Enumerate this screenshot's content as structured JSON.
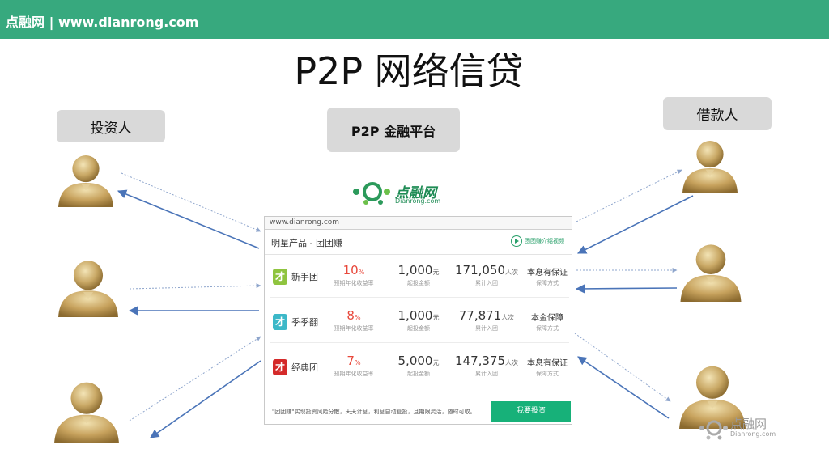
{
  "header": {
    "text": "点融网 | www.dianrong.com",
    "color": "#37a97e"
  },
  "title": "P2P 网络信贷",
  "labels": {
    "investor": "投资人",
    "platform": "P2P  金融平台",
    "borrower": "借款人"
  },
  "logo": {
    "cn": "点融网",
    "en": "Dianrong.com"
  },
  "panel": {
    "url": "www.dianrong.com",
    "heading": "明星产品 - 团团赚",
    "video_link": "团团赚介绍视频",
    "products": [
      {
        "badge": "才",
        "badge_color": "#8fc43f",
        "name": "新手团",
        "rate": "10",
        "rate_unit": "%",
        "rate_label": "预期年化收益率",
        "min": "1,000",
        "min_unit": "元",
        "min_label": "起投金额",
        "count": "171,050",
        "count_unit": "人次",
        "count_label": "累计入团",
        "guarantee": "本息有保证",
        "guarantee_label": "保障方式"
      },
      {
        "badge": "才",
        "badge_color": "#3cb8c8",
        "name": "季季翻",
        "rate": "8",
        "rate_unit": "%",
        "rate_label": "预期年化收益率",
        "min": "1,000",
        "min_unit": "元",
        "min_label": "起投金额",
        "count": "77,871",
        "count_unit": "人次",
        "count_label": "累计入团",
        "guarantee": "本金保障",
        "guarantee_label": "保障方式"
      },
      {
        "badge": "才",
        "badge_color": "#d42a2a",
        "name": "经典团",
        "rate": "7",
        "rate_unit": "%",
        "rate_label": "预期年化收益率",
        "min": "5,000",
        "min_unit": "元",
        "min_label": "起投金额",
        "count": "147,375",
        "count_unit": "人次",
        "count_label": "累计入团",
        "guarantee": "本息有保证",
        "guarantee_label": "保障方式"
      }
    ],
    "footer": "\"团团赚\"实现投资风险分散，天天计息，利息自动复投，且期限灵活，随时可取。",
    "button": "我要投资"
  },
  "watermark": {
    "cn": "点融网",
    "en": "Dianrong.com"
  }
}
